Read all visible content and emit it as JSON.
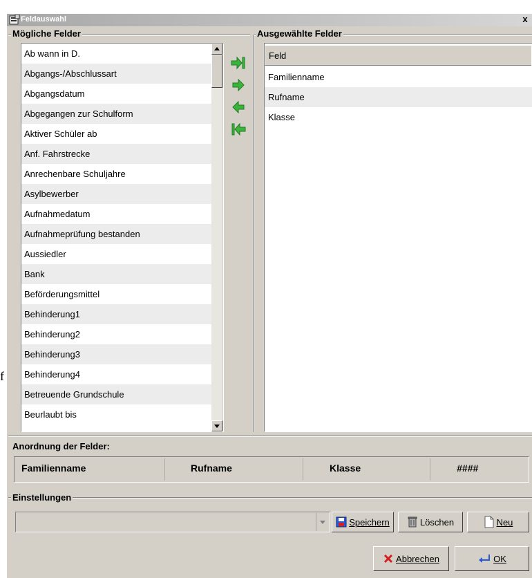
{
  "window": {
    "title": "Feldauswahl",
    "close_glyph": "x"
  },
  "stray_char": "f",
  "available": {
    "label": "Mögliche Felder",
    "items": [
      "Ab wann in D.",
      "Abgangs-/Abschlussart",
      "Abgangsdatum",
      "Abgegangen zur Schulform",
      "Aktiver Schüler ab",
      "Anf. Fahrstrecke",
      "Anrechenbare Schuljahre",
      "Asylbewerber",
      "Aufnahmedatum",
      "Aufnahmeprüfung bestanden",
      "Aussiedler",
      "Bank",
      "Beförderungsmittel",
      "Behinderung1",
      "Behinderung2",
      "Behinderung3",
      "Behinderung4",
      "Betreuende Grundschule",
      "Beurlaubt bis"
    ],
    "scroll": {
      "position_fraction": 0.0
    }
  },
  "move_buttons": [
    {
      "name": "add-all-icon",
      "glyph": "⇥"
    },
    {
      "name": "add-icon",
      "glyph": "⇨"
    },
    {
      "name": "remove-icon",
      "glyph": "⇦"
    },
    {
      "name": "remove-all-icon",
      "glyph": "⇤"
    }
  ],
  "selected": {
    "label": "Ausgewählte Felder",
    "column_header": "Feld",
    "items": [
      "Familienname",
      "Rufname",
      "Klasse"
    ]
  },
  "arrangement": {
    "label": "Anordnung der Felder:",
    "columns": [
      "Familienname",
      "Rufname",
      "Klasse",
      "####"
    ]
  },
  "settings": {
    "label": "Einstellungen",
    "combo_value": "",
    "save_label": "Speichern",
    "delete_label": "Löschen",
    "new_label": "Neu"
  },
  "footer": {
    "cancel_label": "Abbrechen",
    "ok_label": "OK"
  },
  "colors": {
    "arrow_green": "#3cb43c",
    "delete_red": "#d42020",
    "save_blue": "#2a5bd7"
  }
}
